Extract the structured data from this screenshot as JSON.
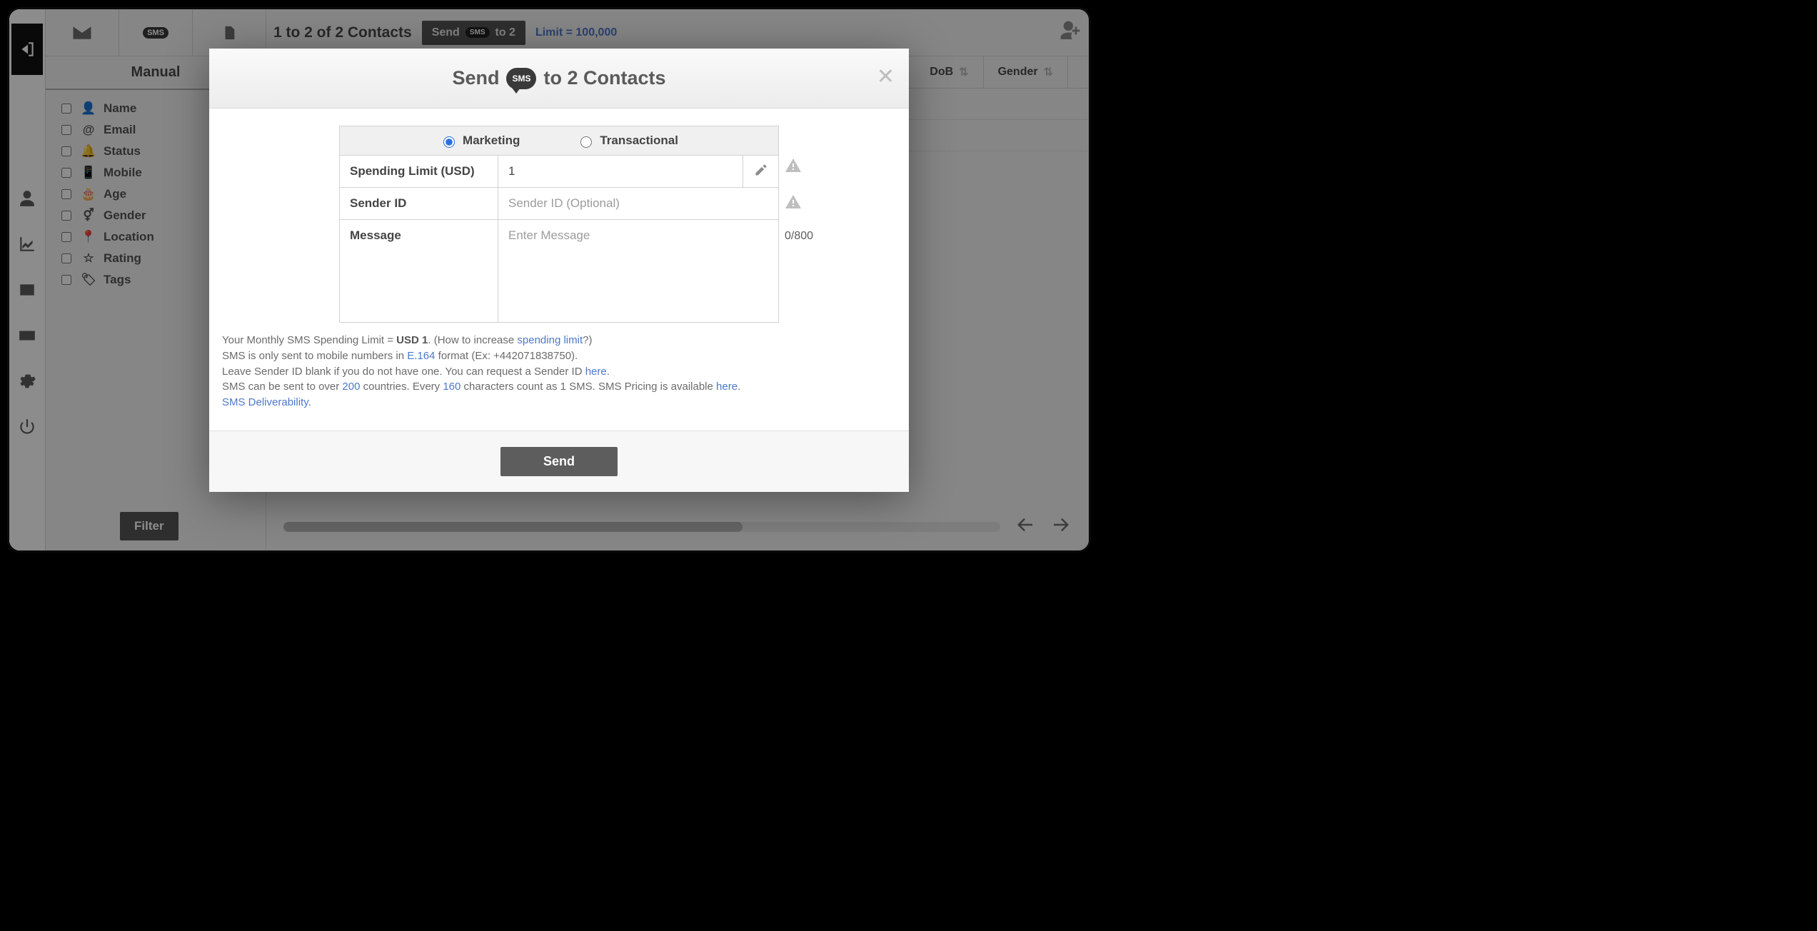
{
  "rail": {
    "items": [
      "logo",
      "contacts",
      "reports",
      "cards",
      "billing",
      "settings",
      "power"
    ]
  },
  "sidebar": {
    "tab_label": "Manual",
    "fields": [
      {
        "icon": "user",
        "label": "Name"
      },
      {
        "icon": "at",
        "label": "Email"
      },
      {
        "icon": "bell",
        "label": "Status"
      },
      {
        "icon": "mobile",
        "label": "Mobile"
      },
      {
        "icon": "cake",
        "label": "Age"
      },
      {
        "icon": "gender",
        "label": "Gender"
      },
      {
        "icon": "pin",
        "label": "Location"
      },
      {
        "icon": "star",
        "label": "Rating"
      },
      {
        "icon": "tag",
        "label": "Tags"
      }
    ],
    "filter_label": "Filter"
  },
  "topbar": {
    "count_text": "1 to 2 of 2 Contacts",
    "send_label_pre": "Send",
    "send_label_post": "to 2",
    "limit_text": "Limit = 100,000"
  },
  "columns": {
    "dob": "DoB",
    "gender": "Gender"
  },
  "modal": {
    "title_pre": "Send",
    "title_post": "to 2 Contacts",
    "type_marketing": "Marketing",
    "type_transactional": "Transactional",
    "row_spending_label": "Spending Limit (USD)",
    "spending_value": "1",
    "row_sender_label": "Sender ID",
    "sender_placeholder": "Sender ID (Optional)",
    "row_message_label": "Message",
    "message_placeholder": "Enter Message",
    "char_counter": "0/800",
    "notes": {
      "l1_a": "Your Monthly SMS Spending Limit = ",
      "l1_b": "USD 1",
      "l1_c": ". (How to increase ",
      "l1_link": "spending limit",
      "l1_d": "?)",
      "l2_a": "SMS is only sent to mobile numbers in ",
      "l2_link": "E.164",
      "l2_b": " format (Ex: +442071838750).",
      "l3_a": "Leave Sender ID blank if you do not have one. You can request a Sender ID ",
      "l3_link": "here",
      "l3_b": ".",
      "l4_a": "SMS can be sent to over ",
      "l4_link1": "200",
      "l4_b": " countries. Every ",
      "l4_link2": "160",
      "l4_c": " characters count as 1 SMS. SMS Pricing is available ",
      "l4_link3": "here",
      "l4_d": ".",
      "l5_link": "SMS Deliverability",
      "l5_b": "."
    },
    "send_label": "Send"
  }
}
